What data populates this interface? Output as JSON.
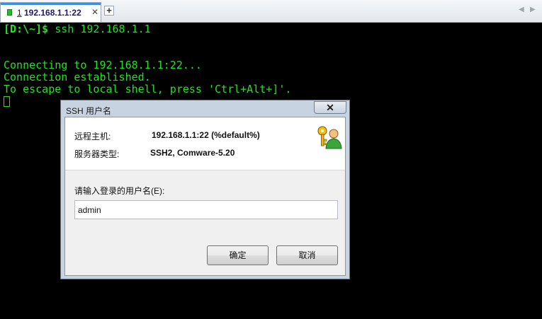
{
  "tabs": [
    {
      "number": "1",
      "title": "192.168.1.1:22",
      "active": true,
      "close_glyph": "✕"
    }
  ],
  "tab_add_glyph": "+",
  "nav": {
    "left_glyph": "◀",
    "right_glyph": "▶"
  },
  "colors": {
    "terminal_bg": "#000000",
    "terminal_fg": "#1fe41f",
    "tab_status": "#1fbf2c",
    "dialog_frame": "#c7d3e1"
  },
  "terminal": {
    "prompt": "[D:\\~]$",
    "command": " ssh 192.168.1.1",
    "lines": [
      "Connecting to 192.168.1.1:22...",
      "Connection established.",
      "To escape to local shell, press 'Ctrl+Alt+]'."
    ]
  },
  "dialog": {
    "title": "SSH 用户名",
    "close_glyph": "✕",
    "remote_host_label": "远程主机:",
    "remote_host_value": "192.168.1.1:22 (%default%)",
    "server_type_label": "服务器类型:",
    "server_type_value": "SSH2, Comware-5.20",
    "username_prompt": "请输入登录的用户名(E):",
    "username_value": "admin",
    "ok_label": "确定",
    "cancel_label": "取消",
    "icon": "key-user-icon"
  }
}
